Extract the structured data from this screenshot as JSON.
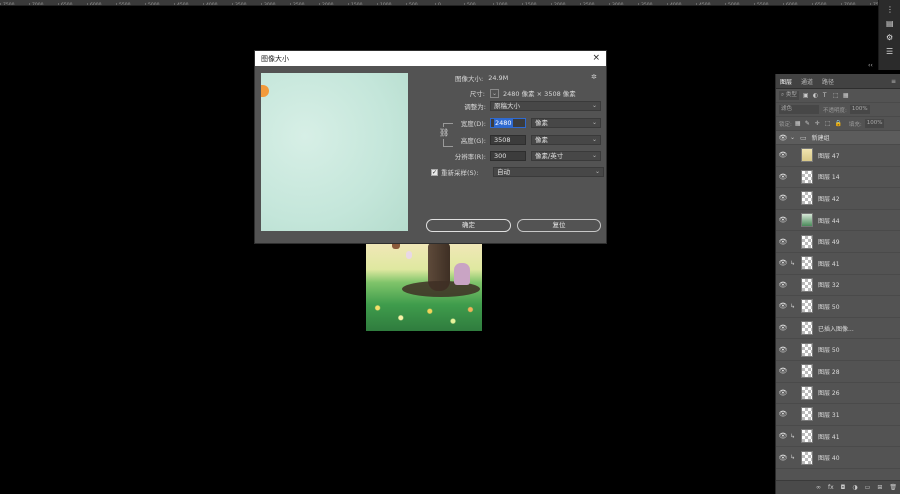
{
  "ruler": {
    "ticks": [
      "7500",
      "7000",
      "6500",
      "6000",
      "5500",
      "5000",
      "4500",
      "4000",
      "3500",
      "3000",
      "2500",
      "2000",
      "1500",
      "1000",
      "500",
      "0",
      "500",
      "1000",
      "1500",
      "2000",
      "2500",
      "3000",
      "3500",
      "4000",
      "4500",
      "5000",
      "5500",
      "6000",
      "6500",
      "7000",
      "7500"
    ]
  },
  "dialog": {
    "title": "图像大小",
    "close_icon": "×",
    "image_size_label": "图像大小:",
    "image_size_value": "24.9M",
    "dimensions_label": "尺寸:",
    "dimensions_value": "2480 像素 × 3508 像素",
    "fit_to_label": "调整为:",
    "fit_to_value": "原稿大小",
    "width_label": "宽度(D):",
    "width_value": "2480",
    "width_unit": "像素",
    "height_label": "高度(G):",
    "height_value": "3508",
    "height_unit": "像素",
    "resolution_label": "分辨率(R):",
    "resolution_value": "300",
    "resolution_unit": "像素/英寸",
    "resample_label": "重新采样(S):",
    "resample_value": "自动",
    "resample_checked": true,
    "ok_label": "确定",
    "reset_label": "复位"
  },
  "layers_panel": {
    "tabs": [
      "图层",
      "通道",
      "路径"
    ],
    "active_tab": "图层",
    "filter_label": "类型",
    "blend_mode": "滤色",
    "opacity_label": "不透明度:",
    "opacity_value": "100%",
    "lock_label": "锁定:",
    "fill_label": "填充:",
    "fill_value": "100%",
    "group_name": "新建组",
    "layers": [
      {
        "name": "图层 47",
        "clipped": false,
        "thumb": "yellow"
      },
      {
        "name": "图层 14",
        "clipped": false,
        "thumb": "empty"
      },
      {
        "name": "图层 42",
        "clipped": false,
        "thumb": "empty"
      },
      {
        "name": "图层 44",
        "clipped": false,
        "thumb": "art"
      },
      {
        "name": "图层 49",
        "clipped": false,
        "thumb": "empty"
      },
      {
        "name": "图层 41",
        "clipped": true,
        "thumb": "empty"
      },
      {
        "name": "图层 32",
        "clipped": false,
        "thumb": "empty"
      },
      {
        "name": "图层 50",
        "clipped": true,
        "thumb": "empty"
      },
      {
        "name": "已插入图像...",
        "clipped": false,
        "thumb": "empty"
      },
      {
        "name": "图层 50",
        "clipped": false,
        "thumb": "empty"
      },
      {
        "name": "图层 28",
        "clipped": false,
        "thumb": "empty"
      },
      {
        "name": "图层 26",
        "clipped": false,
        "thumb": "empty"
      },
      {
        "name": "图层 31",
        "clipped": false,
        "thumb": "empty"
      },
      {
        "name": "图层 41",
        "clipped": true,
        "thumb": "empty"
      },
      {
        "name": "图层 40",
        "clipped": true,
        "thumb": "empty"
      }
    ]
  }
}
